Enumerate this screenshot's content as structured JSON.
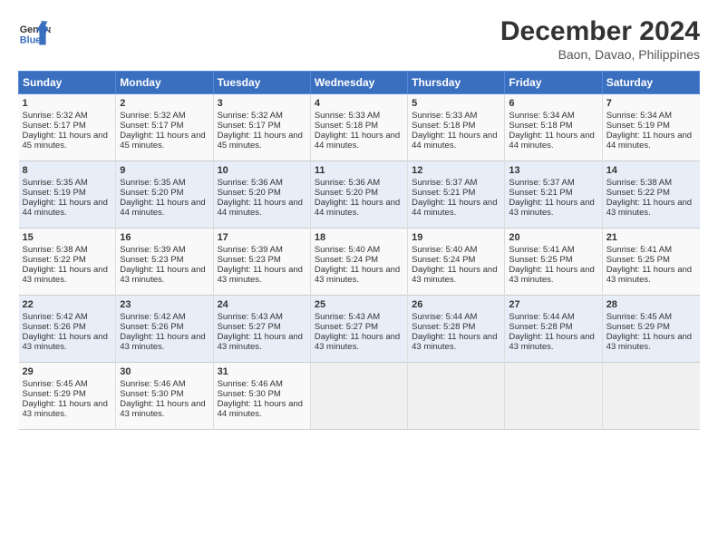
{
  "header": {
    "logo_line1": "General",
    "logo_line2": "Blue",
    "month": "December 2024",
    "location": "Baon, Davao, Philippines"
  },
  "days_of_week": [
    "Sunday",
    "Monday",
    "Tuesday",
    "Wednesday",
    "Thursday",
    "Friday",
    "Saturday"
  ],
  "weeks": [
    [
      {
        "day": 1,
        "sunrise": "5:32 AM",
        "sunset": "5:17 PM",
        "daylight": "11 hours and 45 minutes."
      },
      {
        "day": 2,
        "sunrise": "5:32 AM",
        "sunset": "5:17 PM",
        "daylight": "11 hours and 45 minutes."
      },
      {
        "day": 3,
        "sunrise": "5:32 AM",
        "sunset": "5:17 PM",
        "daylight": "11 hours and 45 minutes."
      },
      {
        "day": 4,
        "sunrise": "5:33 AM",
        "sunset": "5:18 PM",
        "daylight": "11 hours and 44 minutes."
      },
      {
        "day": 5,
        "sunrise": "5:33 AM",
        "sunset": "5:18 PM",
        "daylight": "11 hours and 44 minutes."
      },
      {
        "day": 6,
        "sunrise": "5:34 AM",
        "sunset": "5:18 PM",
        "daylight": "11 hours and 44 minutes."
      },
      {
        "day": 7,
        "sunrise": "5:34 AM",
        "sunset": "5:19 PM",
        "daylight": "11 hours and 44 minutes."
      }
    ],
    [
      {
        "day": 8,
        "sunrise": "5:35 AM",
        "sunset": "5:19 PM",
        "daylight": "11 hours and 44 minutes."
      },
      {
        "day": 9,
        "sunrise": "5:35 AM",
        "sunset": "5:20 PM",
        "daylight": "11 hours and 44 minutes."
      },
      {
        "day": 10,
        "sunrise": "5:36 AM",
        "sunset": "5:20 PM",
        "daylight": "11 hours and 44 minutes."
      },
      {
        "day": 11,
        "sunrise": "5:36 AM",
        "sunset": "5:20 PM",
        "daylight": "11 hours and 44 minutes."
      },
      {
        "day": 12,
        "sunrise": "5:37 AM",
        "sunset": "5:21 PM",
        "daylight": "11 hours and 44 minutes."
      },
      {
        "day": 13,
        "sunrise": "5:37 AM",
        "sunset": "5:21 PM",
        "daylight": "11 hours and 43 minutes."
      },
      {
        "day": 14,
        "sunrise": "5:38 AM",
        "sunset": "5:22 PM",
        "daylight": "11 hours and 43 minutes."
      }
    ],
    [
      {
        "day": 15,
        "sunrise": "5:38 AM",
        "sunset": "5:22 PM",
        "daylight": "11 hours and 43 minutes."
      },
      {
        "day": 16,
        "sunrise": "5:39 AM",
        "sunset": "5:23 PM",
        "daylight": "11 hours and 43 minutes."
      },
      {
        "day": 17,
        "sunrise": "5:39 AM",
        "sunset": "5:23 PM",
        "daylight": "11 hours and 43 minutes."
      },
      {
        "day": 18,
        "sunrise": "5:40 AM",
        "sunset": "5:24 PM",
        "daylight": "11 hours and 43 minutes."
      },
      {
        "day": 19,
        "sunrise": "5:40 AM",
        "sunset": "5:24 PM",
        "daylight": "11 hours and 43 minutes."
      },
      {
        "day": 20,
        "sunrise": "5:41 AM",
        "sunset": "5:25 PM",
        "daylight": "11 hours and 43 minutes."
      },
      {
        "day": 21,
        "sunrise": "5:41 AM",
        "sunset": "5:25 PM",
        "daylight": "11 hours and 43 minutes."
      }
    ],
    [
      {
        "day": 22,
        "sunrise": "5:42 AM",
        "sunset": "5:26 PM",
        "daylight": "11 hours and 43 minutes."
      },
      {
        "day": 23,
        "sunrise": "5:42 AM",
        "sunset": "5:26 PM",
        "daylight": "11 hours and 43 minutes."
      },
      {
        "day": 24,
        "sunrise": "5:43 AM",
        "sunset": "5:27 PM",
        "daylight": "11 hours and 43 minutes."
      },
      {
        "day": 25,
        "sunrise": "5:43 AM",
        "sunset": "5:27 PM",
        "daylight": "11 hours and 43 minutes."
      },
      {
        "day": 26,
        "sunrise": "5:44 AM",
        "sunset": "5:28 PM",
        "daylight": "11 hours and 43 minutes."
      },
      {
        "day": 27,
        "sunrise": "5:44 AM",
        "sunset": "5:28 PM",
        "daylight": "11 hours and 43 minutes."
      },
      {
        "day": 28,
        "sunrise": "5:45 AM",
        "sunset": "5:29 PM",
        "daylight": "11 hours and 43 minutes."
      }
    ],
    [
      {
        "day": 29,
        "sunrise": "5:45 AM",
        "sunset": "5:29 PM",
        "daylight": "11 hours and 43 minutes."
      },
      {
        "day": 30,
        "sunrise": "5:46 AM",
        "sunset": "5:30 PM",
        "daylight": "11 hours and 43 minutes."
      },
      {
        "day": 31,
        "sunrise": "5:46 AM",
        "sunset": "5:30 PM",
        "daylight": "11 hours and 44 minutes."
      },
      null,
      null,
      null,
      null
    ]
  ]
}
